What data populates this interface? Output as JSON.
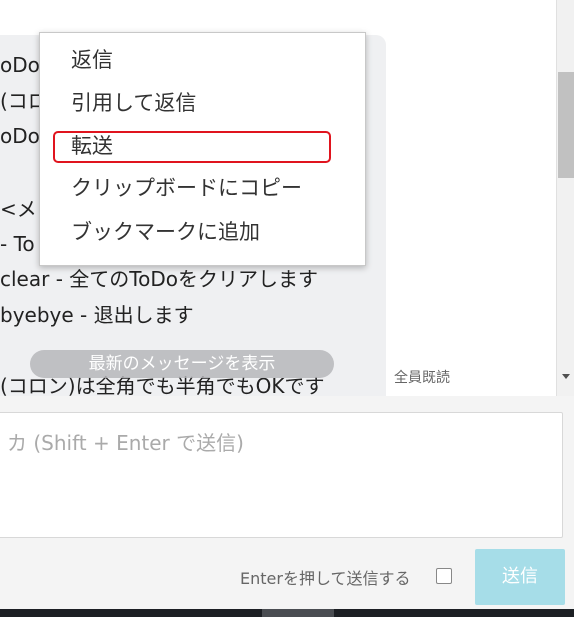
{
  "messages": {
    "lines": [
      "oDo",
      "(コロ",
      "oDo",
      "<メ",
      "- To",
      "clear - 全てのToDoをクリアします",
      "byebye - 退出します",
      "(コロン)は全角でも半角でもOKです"
    ],
    "read_status": "全員既読",
    "latest_button": "最新のメッセージを表示"
  },
  "context_menu": {
    "items": [
      "返信",
      "引用して返信",
      "転送",
      "クリップボードにコピー",
      "ブックマークに追加"
    ],
    "highlighted": "転送",
    "highlight_color": "#e0141e"
  },
  "composer": {
    "placeholder": "カ (Shift + Enter で送信)",
    "enter_to_send_label": "Enterを押して送信する",
    "enter_to_send_checked": false,
    "send_label": "送信",
    "send_color": "#a6dde8"
  }
}
